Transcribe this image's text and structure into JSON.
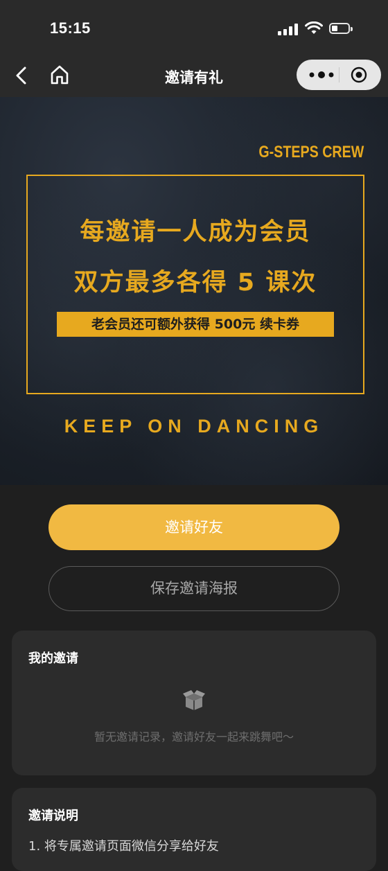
{
  "status_bar": {
    "time": "15:15",
    "icons": [
      "signal-icon",
      "wifi-icon",
      "battery-icon"
    ]
  },
  "nav": {
    "title": "邀请有礼",
    "icons": [
      "back-icon",
      "home-icon",
      "more-icon",
      "close-target-icon"
    ]
  },
  "banner": {
    "brand": "G-STEPS CREW",
    "headline_1": "每邀请一人成为会员",
    "headline_2": "双方最多各得 5 课次",
    "highlight": "老会员还可额外获得 500元 续卡券",
    "slogan": "KEEP ON DANCING"
  },
  "actions": {
    "invite_label": "邀请好友",
    "save_poster_label": "保存邀请海报"
  },
  "my_invites": {
    "title": "我的邀请",
    "empty_text": "暂无邀请记录，邀请好友一起来跳舞吧～"
  },
  "rules": {
    "title": "邀请说明",
    "items": [
      "1. 将专属邀请页面微信分享给好友"
    ]
  },
  "colors": {
    "accent_gold": "#e7a91f",
    "button_yellow": "#f1b942",
    "background": "#1f1f1f",
    "card": "#2c2c2c"
  }
}
